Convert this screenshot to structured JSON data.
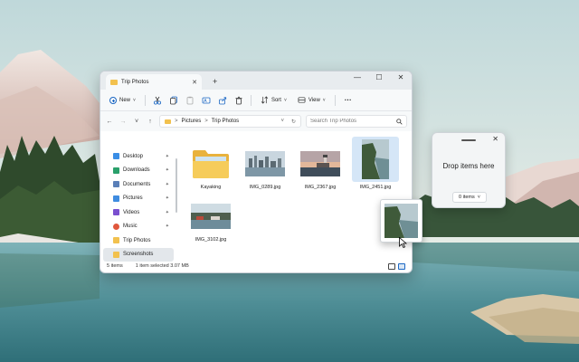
{
  "window": {
    "tab_title": "Trip Photos",
    "new_tab": "+",
    "minimize": "—",
    "maximize": "☐",
    "close": "✕"
  },
  "toolbar": {
    "new_label": "New",
    "sort_label": "Sort",
    "view_label": "View",
    "more_label": "···"
  },
  "address": {
    "back": "←",
    "forward": "→",
    "recent": "˅",
    "up": "↑",
    "crumbs": [
      "Pictures",
      "Trip Photos"
    ],
    "crumb_sep": ">",
    "dropdown": "˅",
    "refresh": "↻",
    "search_placeholder": "Search Trip Photos",
    "search_icon": "search-icon"
  },
  "sidebar": {
    "items": [
      {
        "label": "Desktop",
        "icon": "desktop-icon",
        "color": "#3a8ee6",
        "pinned": true
      },
      {
        "label": "Downloads",
        "icon": "downloads-icon",
        "color": "#2aa06b",
        "pinned": true
      },
      {
        "label": "Documents",
        "icon": "documents-icon",
        "color": "#5a7fb8",
        "pinned": true
      },
      {
        "label": "Pictures",
        "icon": "pictures-icon",
        "color": "#3f8ce0",
        "pinned": true
      },
      {
        "label": "Videos",
        "icon": "videos-icon",
        "color": "#7a4fcf",
        "pinned": true
      },
      {
        "label": "Music",
        "icon": "music-icon",
        "color": "#e0573c",
        "pinned": true
      },
      {
        "label": "Trip Photos",
        "icon": "folder-icon",
        "color": "#f2c14e",
        "pinned": false
      },
      {
        "label": "Screenshots",
        "icon": "folder-icon",
        "color": "#f2c14e",
        "pinned": false
      }
    ],
    "pin_glyph": "📌"
  },
  "files": [
    {
      "name": "Kayaking",
      "type": "folder"
    },
    {
      "name": "IMG_0289.jpg",
      "type": "image"
    },
    {
      "name": "IMG_2367.jpg",
      "type": "image"
    },
    {
      "name": "IMG_2451.jpg",
      "type": "image",
      "selected": true
    },
    {
      "name": "IMG_3102.jpg",
      "type": "image"
    }
  ],
  "status": {
    "items": "5 items",
    "selected": "1 item selected  3.07 MB"
  },
  "drop_panel": {
    "title": "Drop items here",
    "count": "0 items",
    "count_chevron": "˅",
    "close": "✕"
  },
  "colors": {
    "accent": "#1b67c4",
    "folder": "#f2c14e"
  }
}
